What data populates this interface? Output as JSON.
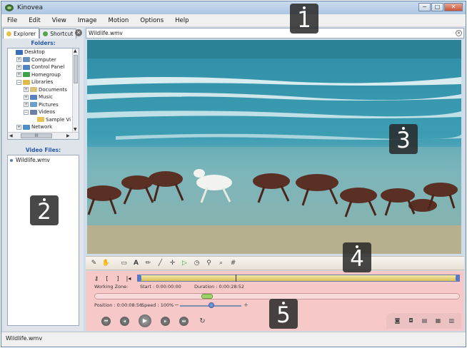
{
  "window": {
    "title": "Kinovea",
    "minimize_glyph": "−",
    "maximize_glyph": "□",
    "close_glyph": "✕"
  },
  "menu": [
    "File",
    "Edit",
    "View",
    "Image",
    "Motion",
    "Options",
    "Help"
  ],
  "left_panel": {
    "tabs": [
      {
        "label": "Explorer",
        "icon": "explorer-icon"
      },
      {
        "label": "Shortcut",
        "icon": "shortcut-icon"
      }
    ],
    "folders_heading": "Folders:",
    "tree": [
      {
        "label": "Desktop",
        "level": 0,
        "expander": "",
        "icon_color": "#3a6fb8"
      },
      {
        "label": "Computer",
        "level": 1,
        "expander": "+",
        "icon_color": "#6a8fb8"
      },
      {
        "label": "Control Panel",
        "level": 1,
        "expander": "+",
        "icon_color": "#4f83c4"
      },
      {
        "label": "Homegroup",
        "level": 1,
        "expander": "+",
        "icon_color": "#3fa04a"
      },
      {
        "label": "Libraries",
        "level": 1,
        "expander": "−",
        "icon_color": "#e0b94d"
      },
      {
        "label": "Documents",
        "level": 2,
        "expander": "+",
        "icon_color": "#d9c27a"
      },
      {
        "label": "Music",
        "level": 2,
        "expander": "+",
        "icon_color": "#5a7fc2"
      },
      {
        "label": "Pictures",
        "level": 2,
        "expander": "+",
        "icon_color": "#6d9fc9"
      },
      {
        "label": "Videos",
        "level": 2,
        "expander": "−",
        "icon_color": "#6d7fa5"
      },
      {
        "label": "Sample Vi",
        "level": 3,
        "expander": "",
        "icon_color": "#e8c255"
      },
      {
        "label": "Network",
        "level": 1,
        "expander": "+",
        "icon_color": "#4d8fc2"
      }
    ],
    "hscroll_thumb_label": "III",
    "video_files_heading": "Video Files:",
    "files": [
      "Wildlife.wmv"
    ]
  },
  "file_tab": {
    "label": "Wildlife.wmv"
  },
  "drawing_tools": [
    "add-keyframe-icon",
    "hand-icon",
    "comment-icon",
    "text-icon",
    "pencil-icon",
    "line-icon",
    "cross-icon",
    "angle-icon",
    "chrono-icon",
    "magnifier-icon",
    "zoom-icon",
    "grid-icon"
  ],
  "player": {
    "working_zone_label": "Working Zone:",
    "start_text": "Start : 0:00:00:00",
    "duration_text": "Duration : 0:00:28:52",
    "position_text": "Position : 0:00:08:56",
    "speed_text": "Speed : 100%",
    "speed_percent": 100
  },
  "statusbar": {
    "text": "Wildlife.wmv"
  },
  "badges": [
    "1",
    "2",
    "3",
    "4",
    "5"
  ]
}
